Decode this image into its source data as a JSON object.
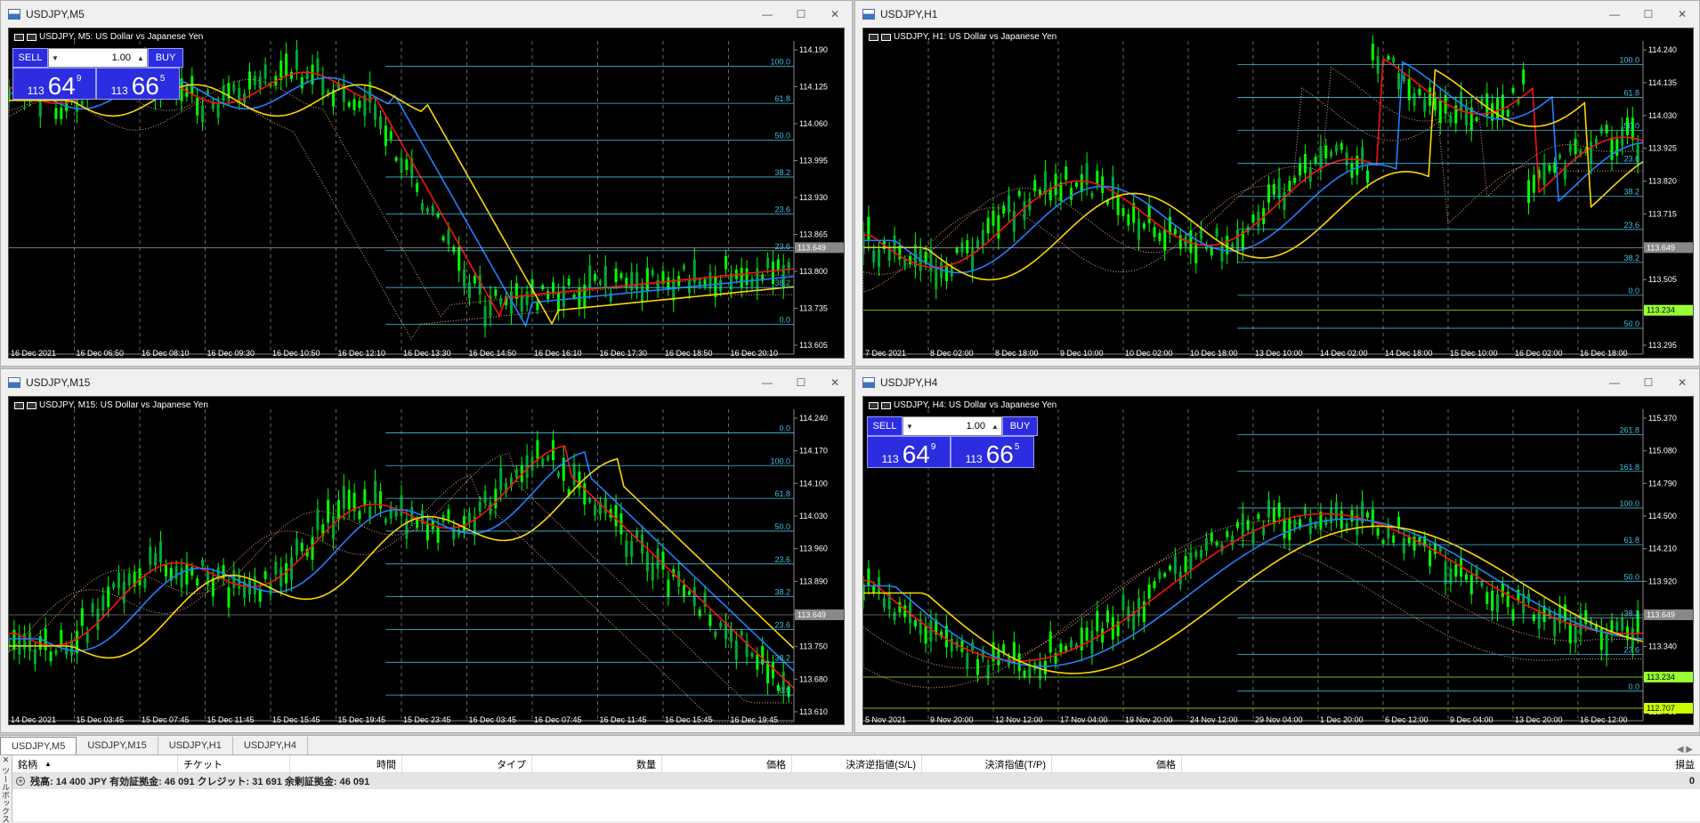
{
  "charts": [
    {
      "id": "m5",
      "window_title": "USDJPY,M5",
      "plot_title": "USDJPY, M5:  US Dollar vs Japanese Yen",
      "has_oneclick": true,
      "price_ticks": [
        "114.190",
        "114.125",
        "114.060",
        "113.995",
        "113.930",
        "113.865",
        "113.800",
        "113.735",
        "113.605"
      ],
      "current_price": "113.649",
      "fib_levels": [
        "100.0",
        "61.8",
        "50.0",
        "38.2",
        "23.6",
        "23.6",
        "38.2",
        "0.0"
      ],
      "time_ticks": [
        "16 Dec 2021",
        "16 Dec 06:50",
        "16 Dec 08:10",
        "16 Dec 09:30",
        "16 Dec 10:50",
        "16 Dec 12:10",
        "16 Dec 13:30",
        "16 Dec 14:50",
        "16 Dec 16:10",
        "16 Dec 17:30",
        "16 Dec 18:50",
        "16 Dec 20:10"
      ]
    },
    {
      "id": "h1",
      "window_title": "USDJPY,H1",
      "plot_title": "USDJPY, H1:  US Dollar vs Japanese Yen",
      "has_oneclick": false,
      "price_ticks": [
        "114.240",
        "114.135",
        "114.030",
        "113.925",
        "113.820",
        "113.715",
        "113.610",
        "113.505",
        "113.400",
        "113.295"
      ],
      "current_price": "113.649",
      "extra_price": "113.234",
      "fib_levels": [
        "100.0",
        "61.8",
        "50.0",
        "23.6",
        "38.2",
        "23.6",
        "38.2",
        "0.0",
        "50.0"
      ],
      "time_ticks": [
        "7 Dec 2021",
        "8 Dec 02:00",
        "8 Dec 18:00",
        "9 Dec 10:00",
        "10 Dec 02:00",
        "10 Dec 18:00",
        "13 Dec 10:00",
        "14 Dec 02:00",
        "14 Dec 18:00",
        "15 Dec 10:00",
        "16 Dec 02:00",
        "16 Dec 18:00"
      ]
    },
    {
      "id": "m15",
      "window_title": "USDJPY,M15",
      "plot_title": "USDJPY, M15:  US Dollar vs Japanese Yen",
      "has_oneclick": false,
      "price_ticks": [
        "114.240",
        "114.170",
        "114.100",
        "114.030",
        "113.960",
        "113.890",
        "113.820",
        "113.750",
        "113.680",
        "113.610"
      ],
      "current_price": "113.649",
      "fib_levels": [
        "0.0",
        "100.0",
        "61.8",
        "50.0",
        "23.6",
        "38.2",
        "23.6",
        "38.2",
        "0.0"
      ],
      "time_ticks": [
        "14 Dec 2021",
        "15 Dec 03:45",
        "15 Dec 07:45",
        "15 Dec 11:45",
        "15 Dec 15:45",
        "15 Dec 19:45",
        "15 Dec 23:45",
        "16 Dec 03:45",
        "16 Dec 07:45",
        "16 Dec 11:45",
        "16 Dec 15:45",
        "16 Dec 19:45"
      ]
    },
    {
      "id": "h4",
      "window_title": "USDJPY,H4",
      "plot_title": "USDJPY, H4:  US Dollar vs Japanese Yen",
      "has_oneclick": true,
      "price_ticks": [
        "115.370",
        "115.080",
        "114.790",
        "114.500",
        "114.210",
        "113.920",
        "113.630",
        "113.340",
        "113.050",
        "112.760"
      ],
      "current_price": "113.649",
      "extra_price": "113.234",
      "extra_price2": "112.707",
      "fib_levels": [
        "261.8",
        "161.8",
        "100.0",
        "61.8",
        "50.0",
        "38.2",
        "23.6",
        "0.0"
      ],
      "time_ticks": [
        "5 Nov 2021",
        "9 Nov 20:00",
        "12 Nov 12:00",
        "17 Nov 04:00",
        "19 Nov 20:00",
        "24 Nov 12:00",
        "29 Nov 04:00",
        "1 Dec 20:00",
        "6 Dec 12:00",
        "9 Dec 04:00",
        "13 Dec 20:00",
        "16 Dec 12:00"
      ]
    }
  ],
  "oneclick": {
    "sell_label": "SELL",
    "buy_label": "BUY",
    "lot": "1.00",
    "sell_prefix": "113",
    "sell_big": "64",
    "sell_sup": "9",
    "buy_prefix": "113",
    "buy_big": "66",
    "buy_sup": "5"
  },
  "tabs": [
    "USDJPY,M5",
    "USDJPY,M15",
    "USDJPY,H1",
    "USDJPY,H4"
  ],
  "active_tab": 0,
  "toolbox": {
    "side_label": "ツールボックス",
    "columns": [
      "銘柄",
      "チケット",
      "時間",
      "タイプ",
      "数量",
      "価格",
      "決済逆指値(S/L)",
      "決済指値(T/P)",
      "価格",
      "損益"
    ],
    "balance_text": "残高: 14 400 JPY  有効証拠金: 46 091  クレジット: 31 691  余剰証拠金: 46 091",
    "balance_profit": "0"
  },
  "colors": {
    "candle": "#00ff00",
    "ma_red": "#ff1010",
    "ma_blue": "#2080ff",
    "ma_yellow": "#ffd700",
    "cloud": "#f4a582",
    "fib": "#40c0e0",
    "oneclick": "#2c2ce0"
  }
}
